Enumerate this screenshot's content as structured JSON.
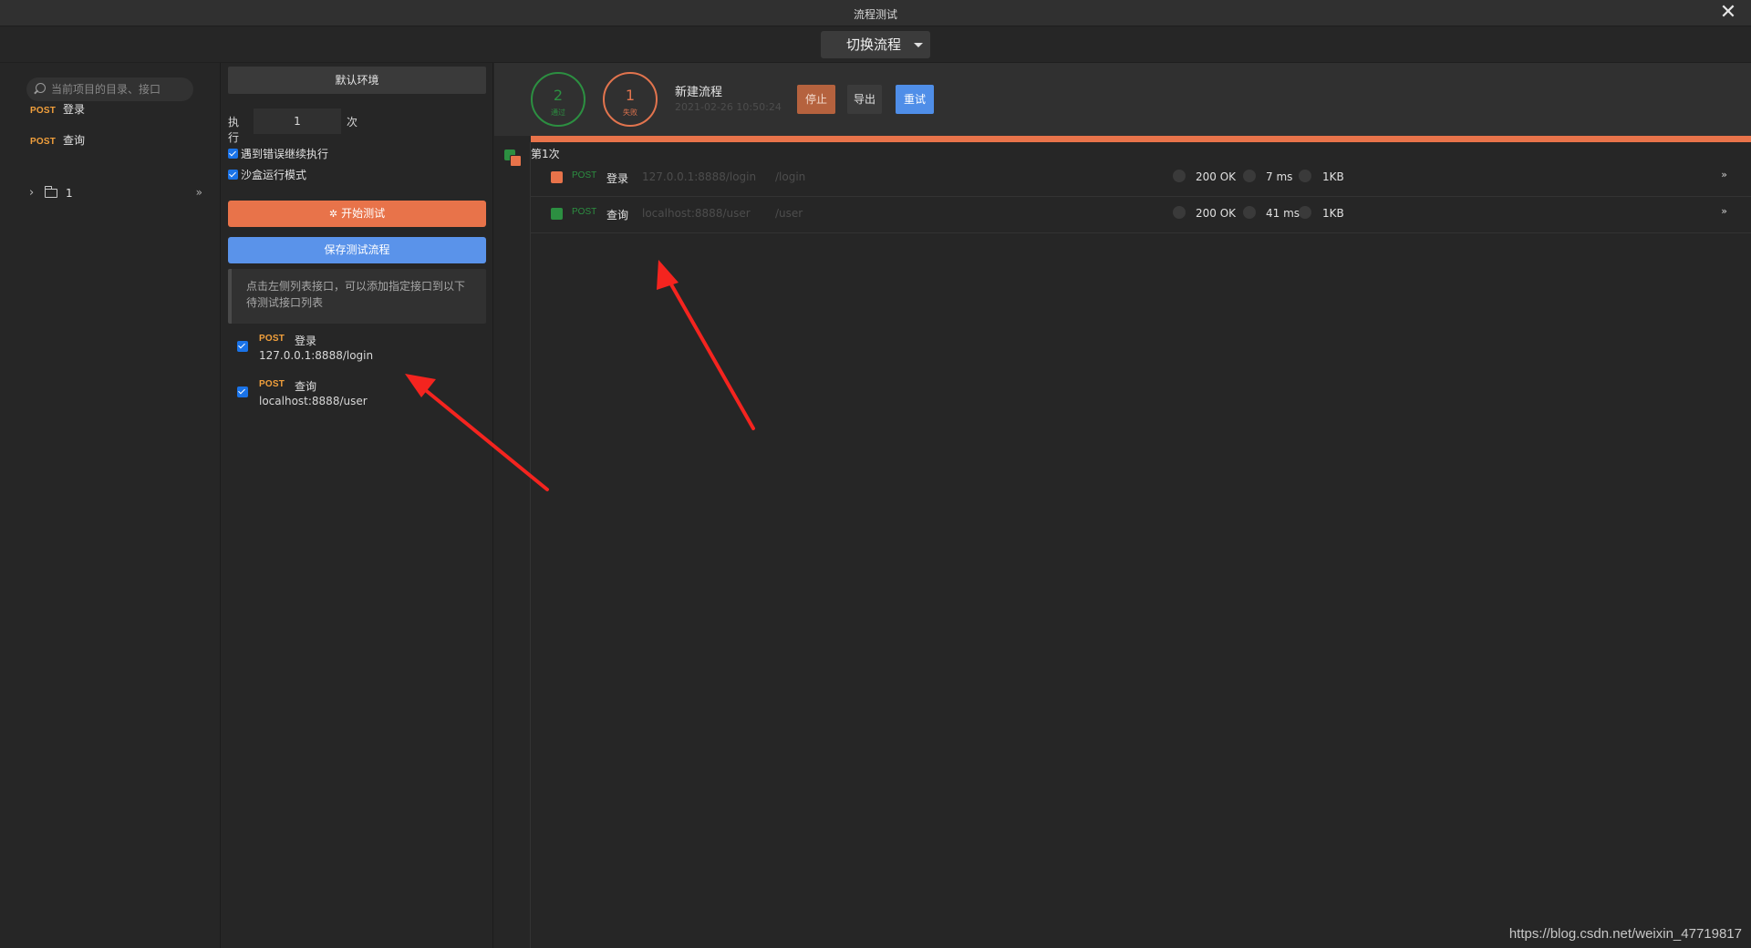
{
  "window": {
    "title": "流程测试"
  },
  "switcher": {
    "label": "切换流程"
  },
  "sidebar": {
    "search_placeholder": "当前项目的目录、接口",
    "items": [
      {
        "method": "POST",
        "name": "登录"
      },
      {
        "method": "POST",
        "name": "查询"
      }
    ],
    "folder": {
      "name": "1"
    }
  },
  "config": {
    "env_label": "默认环境",
    "exec_prefix": "执行",
    "exec_count": "1",
    "exec_suffix": "次",
    "continue_on_error": "遇到错误继续执行",
    "sandbox_mode": "沙盒运行模式",
    "start_label": "开始测试",
    "save_label": "保存测试流程",
    "tip": "点击左侧列表接口，可以添加指定接口到以下待测试接口列表",
    "selected": [
      {
        "method": "POST",
        "name": "登录",
        "url": "127.0.0.1:8888/login"
      },
      {
        "method": "POST",
        "name": "查询",
        "url": "localhost:8888/user"
      }
    ]
  },
  "summary": {
    "pass_count": "2",
    "pass_label": "通过",
    "fail_count": "1",
    "fail_label": "失败",
    "flow_name": "新建流程",
    "flow_time": "2021-02-26 10:50:24",
    "stop_label": "停止",
    "export_label": "导出",
    "retry_label": "重试",
    "progress": 1.0
  },
  "run": {
    "label": "第1次",
    "rows": [
      {
        "status_color": "#e8734a",
        "method": "POST",
        "name": "登录",
        "host": "127.0.0.1:8888/login",
        "path": "/login",
        "code": "200 OK",
        "time": "7 ms",
        "size": "1KB"
      },
      {
        "status_color": "#2c8f41",
        "method": "POST",
        "name": "查询",
        "host": "localhost:8888/user",
        "path": "/user",
        "code": "200 OK",
        "time": "41 ms",
        "size": "1KB"
      }
    ]
  },
  "icons": {
    "close": "close-icon",
    "search": "search-icon",
    "folder": "folder-icon",
    "expand": "double-chevron-icon",
    "spinner": "spinner-icon"
  },
  "colors": {
    "accent_orange": "#e8734a",
    "accent_blue": "#5a93ea",
    "pass_green": "#2c8f41",
    "post_orange": "#f2a03c"
  },
  "watermark": "https://blog.csdn.net/weixin_47719817"
}
